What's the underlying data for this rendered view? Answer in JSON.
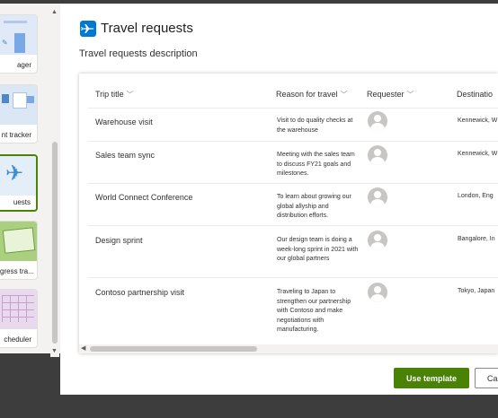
{
  "gallery": {
    "items": [
      {
        "label": "ager"
      },
      {
        "label": "nt tracker"
      },
      {
        "label": "uests"
      },
      {
        "label": "gress tra..."
      },
      {
        "label": "cheduler"
      }
    ]
  },
  "dialog": {
    "title": "Travel requests",
    "description": "Travel requests description",
    "columns": [
      {
        "label": "Trip title"
      },
      {
        "label": "Reason for travel"
      },
      {
        "label": "Requester"
      },
      {
        "label": "Destinatio"
      }
    ],
    "rows": [
      {
        "title": "Warehouse visit",
        "reason": "Visit to do quality checks at the warehouse",
        "destination": "Kennewick, W"
      },
      {
        "title": "Sales team sync",
        "reason": "Meeting with the sales team to discuss FY21 goals and milestones.",
        "destination": "Kennewick, W"
      },
      {
        "title": "World Connect Conference",
        "reason": "To learn about growing our global allyship and distribution efforts.",
        "destination": "London, Eng"
      },
      {
        "title": "Design sprint",
        "reason": "Our design team is doing a week-long sprint in 2021 with our global partners",
        "destination": "Bangalore, In"
      },
      {
        "title": "Contoso partnership visit",
        "reason": "Traveling to Japan to strengthen our partnership with Contoso and make negotiations with manufacturing.",
        "destination": "Tokyo, Japan"
      }
    ],
    "use_template_label": "Use template",
    "cancel_label": "Ca"
  },
  "colors": {
    "accent_green": "#498205",
    "brand_blue": "#0078d4",
    "overlay": "#3d3d3d"
  },
  "icons": {
    "app_logo": "airplane-icon",
    "column_sort": "chevron-down-icon",
    "requester": "person-avatar-icon"
  }
}
